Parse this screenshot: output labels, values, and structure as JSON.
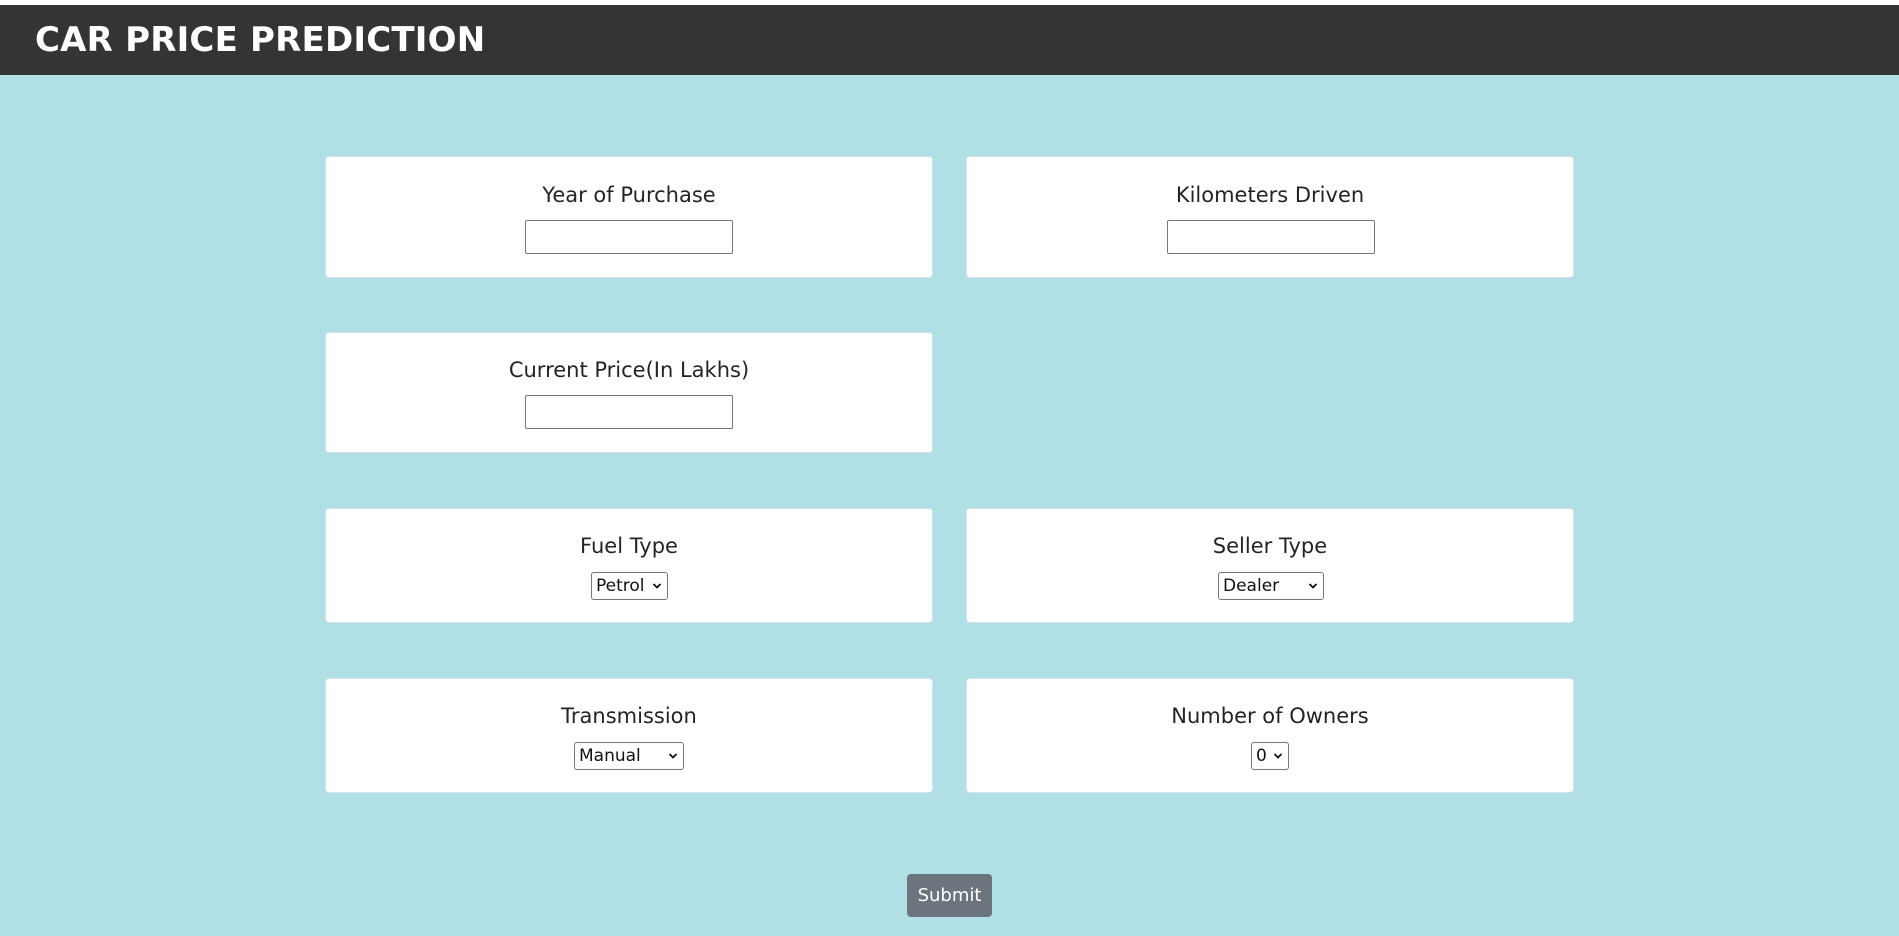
{
  "header": {
    "title": "CAR PRICE PREDICTION"
  },
  "form": {
    "year_of_purchase": {
      "label": "Year of Purchase",
      "value": ""
    },
    "kilometers_driven": {
      "label": "Kilometers Driven",
      "value": ""
    },
    "current_price": {
      "label": "Current Price(In Lakhs)",
      "value": ""
    },
    "fuel_type": {
      "label": "Fuel Type",
      "selected": "Petrol"
    },
    "seller_type": {
      "label": "Seller Type",
      "selected": "Dealer"
    },
    "transmission": {
      "label": "Transmission",
      "selected": "Manual"
    },
    "number_of_owners": {
      "label": "Number of Owners",
      "selected": "0"
    },
    "submit_label": "Submit"
  },
  "colors": {
    "page_background": "#b0dfe5",
    "header_background": "#343434",
    "card_background": "#ffffff",
    "button_background": "#6c757d"
  }
}
